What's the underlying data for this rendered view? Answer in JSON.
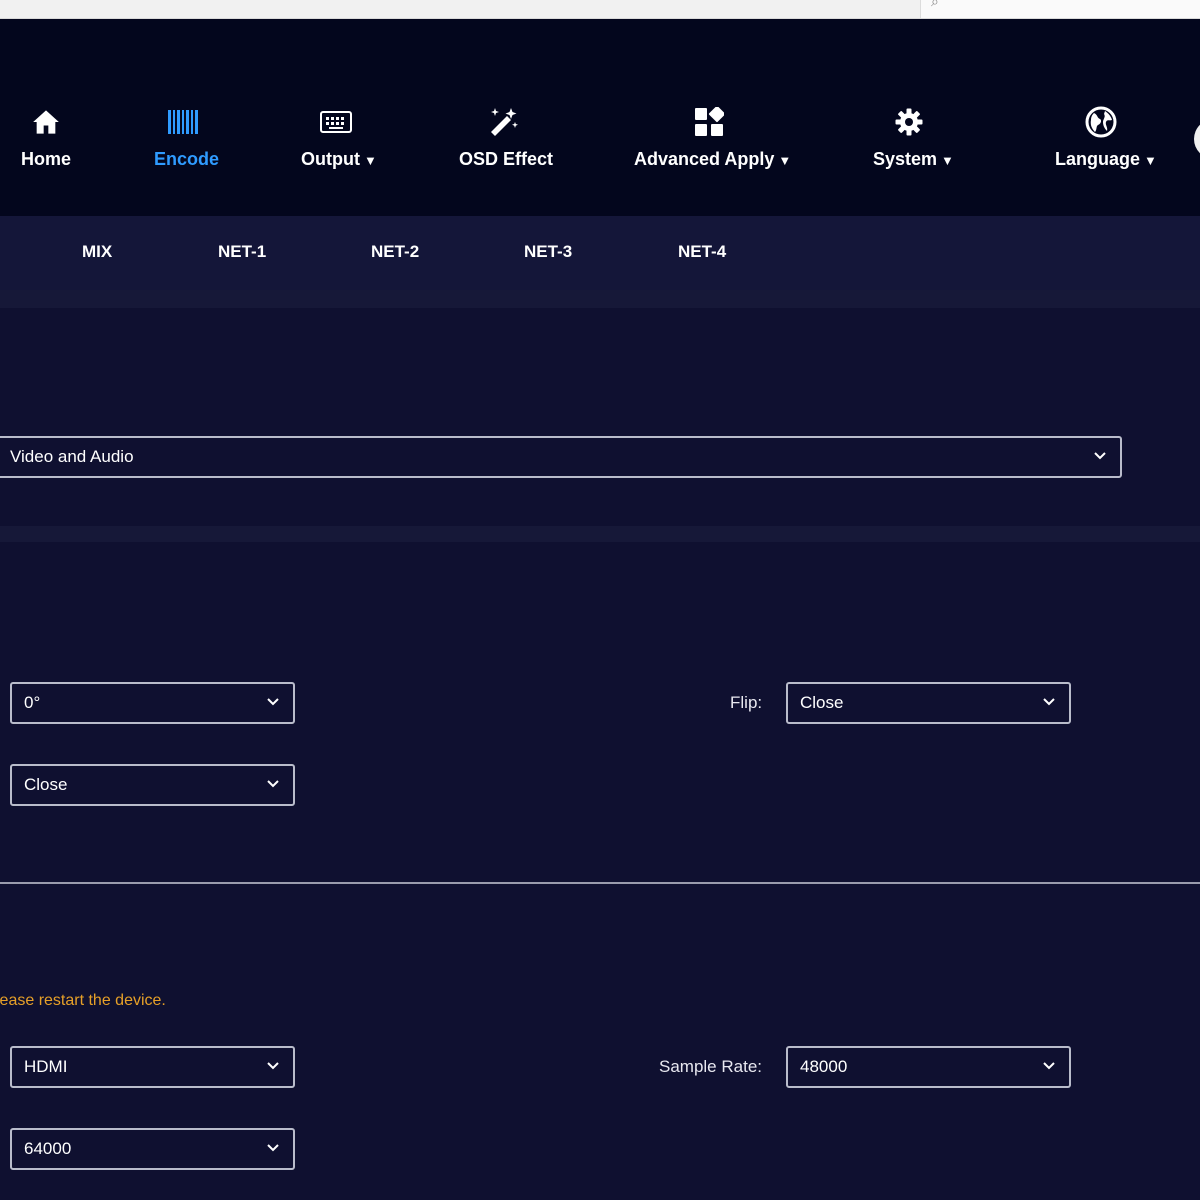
{
  "top_nav": {
    "items": [
      {
        "label": "Home",
        "icon": "home-icon",
        "dropdown": false,
        "active": false
      },
      {
        "label": "Encode",
        "icon": "barcode-icon",
        "dropdown": false,
        "active": true
      },
      {
        "label": "Output",
        "icon": "keyboard-icon",
        "dropdown": true,
        "active": false
      },
      {
        "label": "OSD Effect",
        "icon": "magic-wand-icon",
        "dropdown": false,
        "active": false
      },
      {
        "label": "Advanced Apply",
        "icon": "apps-icon",
        "dropdown": true,
        "active": false
      },
      {
        "label": "System",
        "icon": "gear-icon",
        "dropdown": true,
        "active": false
      },
      {
        "label": "Language",
        "icon": "globe-icon",
        "dropdown": true,
        "active": false
      }
    ],
    "active_color": "#2f9bff",
    "caret": "▼"
  },
  "sub_tabs": [
    "MIX",
    "NET-1",
    "NET-2",
    "NET-3",
    "NET-4"
  ],
  "stream": {
    "mode_value": "Video and Audio"
  },
  "video": {
    "rotate_value": "0°",
    "flip_label": "Flip:",
    "flip_value": "Close",
    "second_value": "Close"
  },
  "audio": {
    "notice": "lease restart the device.",
    "input_value": "HDMI",
    "sample_rate_label": "Sample Rate:",
    "sample_rate_value": "48000",
    "bitrate_value": "64000"
  },
  "colors": {
    "background": "#0f1030",
    "nav_background": "#03061d",
    "notice": "#e6a028"
  }
}
